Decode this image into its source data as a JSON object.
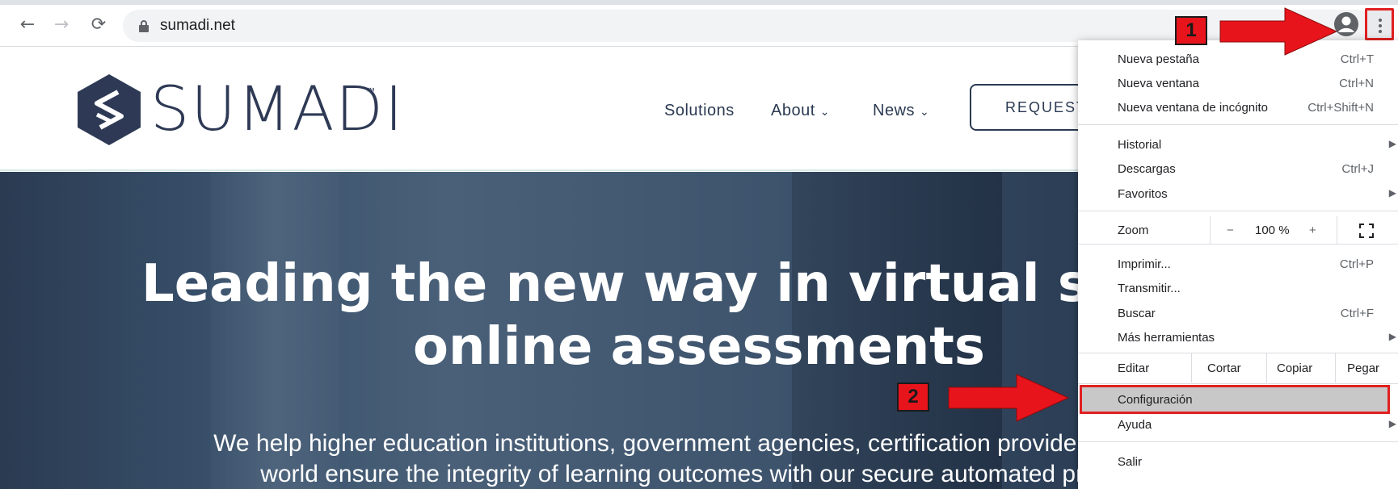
{
  "browser": {
    "url": "sumadi.net",
    "nav": {
      "back_icon": "←",
      "forward_icon": "→",
      "reload_icon": "⟳"
    }
  },
  "site": {
    "logo_text": "SUMADI",
    "logo_tm": "™",
    "nav_items": [
      {
        "label": "Solutions",
        "has_caret": false
      },
      {
        "label": "About",
        "has_caret": true
      },
      {
        "label": "News",
        "has_caret": true
      }
    ],
    "caret": "⌄",
    "cta_label": "REQUEST",
    "hero_title_line1": "Leading the new way in virtual superv",
    "hero_title_line2": "online assessments",
    "hero_sub_line1": "We help higher education institutions, government agencies, certification providers and cor",
    "hero_sub_line2": "world ensure the integrity of learning outcomes with our secure automated proctor"
  },
  "menu": {
    "new_tab": {
      "label": "Nueva pestaña",
      "shortcut": "Ctrl+T"
    },
    "new_window": {
      "label": "Nueva ventana",
      "shortcut": "Ctrl+N"
    },
    "incognito": {
      "label": "Nueva ventana de incógnito",
      "shortcut": "Ctrl+Shift+N"
    },
    "history": {
      "label": "Historial"
    },
    "downloads": {
      "label": "Descargas",
      "shortcut": "Ctrl+J"
    },
    "bookmarks": {
      "label": "Favoritos"
    },
    "zoom": {
      "label": "Zoom",
      "minus": "−",
      "value": "100 %",
      "plus": "+"
    },
    "print": {
      "label": "Imprimir...",
      "shortcut": "Ctrl+P"
    },
    "cast": {
      "label": "Transmitir..."
    },
    "find": {
      "label": "Buscar",
      "shortcut": "Ctrl+F"
    },
    "more_tools": {
      "label": "Más herramientas"
    },
    "edit": {
      "label": "Editar",
      "cut": "Cortar",
      "copy": "Copiar",
      "paste": "Pegar"
    },
    "settings": {
      "label": "Configuración"
    },
    "help": {
      "label": "Ayuda"
    },
    "exit": {
      "label": "Salir"
    },
    "submenu_arrow": "▶"
  },
  "annotations": {
    "step1": "1",
    "step2": "2",
    "highlight_color": "#e02020"
  }
}
